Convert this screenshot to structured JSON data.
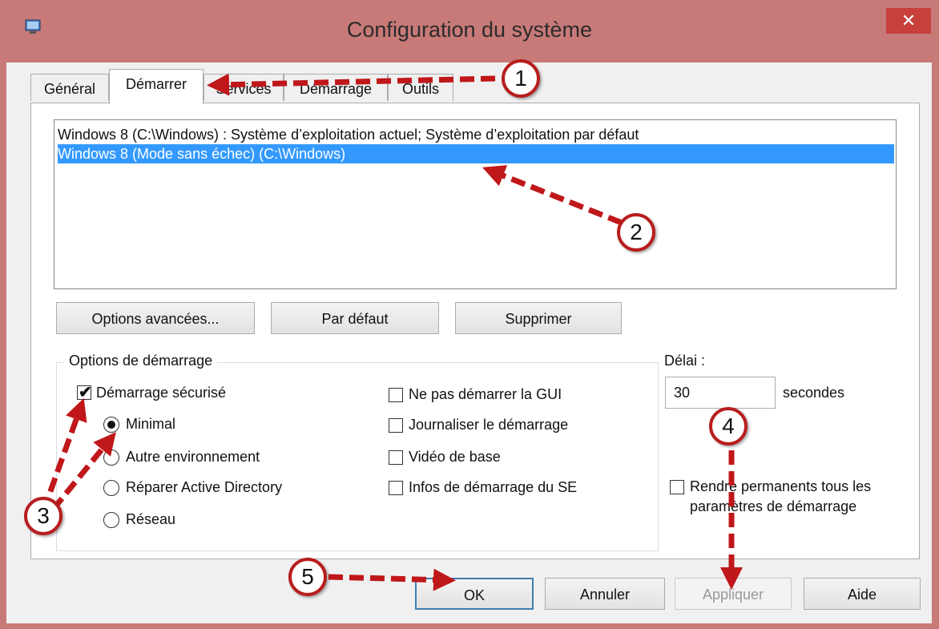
{
  "window": {
    "title": "Configuration du système",
    "close_glyph": "✕"
  },
  "tabs": [
    {
      "label": "Général",
      "active": false
    },
    {
      "label": "Démarrer",
      "active": true
    },
    {
      "label": "Services",
      "active": false
    },
    {
      "label": "Démarrage",
      "active": false
    },
    {
      "label": "Outils",
      "active": false
    }
  ],
  "os_list": [
    {
      "label": "Windows 8 (C:\\Windows) : Système d’exploitation actuel; Système d’exploitation par défaut",
      "selected": false
    },
    {
      "label": "Windows 8 (Mode sans échec) (C:\\Windows)",
      "selected": true
    }
  ],
  "buttons": {
    "advanced": "Options avancées...",
    "default": "Par défaut",
    "delete": "Supprimer"
  },
  "boot_options": {
    "group_label": "Options de démarrage",
    "safe_boot": {
      "label": "Démarrage sécurisé",
      "checked": true
    },
    "radios": [
      {
        "label": "Minimal",
        "selected": true
      },
      {
        "label": "Autre environnement",
        "selected": false
      },
      {
        "label": "Réparer Active Directory",
        "selected": false
      },
      {
        "label": "Réseau",
        "selected": false
      }
    ],
    "right_checks": [
      {
        "label": "Ne pas démarrer la GUI",
        "checked": false
      },
      {
        "label": "Journaliser le démarrage",
        "checked": false
      },
      {
        "label": "Vidéo de base",
        "checked": false
      },
      {
        "label": "Infos de démarrage du SE",
        "checked": false
      }
    ]
  },
  "timeout": {
    "label": "Délai :",
    "value": "30",
    "unit": "secondes"
  },
  "permanent": {
    "label_line1": "Rendre permanents tous les",
    "label_line2": "paramètres de démarrage",
    "checked": false
  },
  "footer": {
    "ok": "OK",
    "cancel": "Annuler",
    "apply": "Appliquer",
    "help": "Aide"
  },
  "annotations": [
    "1",
    "2",
    "3",
    "4",
    "5"
  ],
  "colors": {
    "accent_red": "#b81d1d",
    "selection_blue": "#3399ff",
    "close_red": "#c7403b"
  }
}
